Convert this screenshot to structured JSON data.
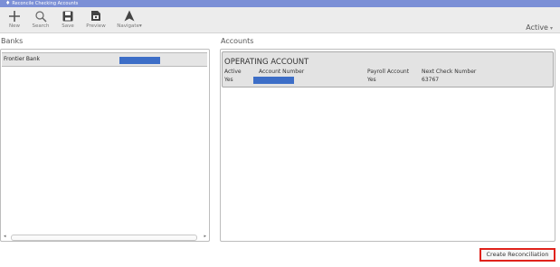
{
  "window": {
    "title": "Reconcile Checking Accounts"
  },
  "toolbar": {
    "new_label": "New",
    "search_label": "Search",
    "save_label": "Save",
    "preview_label": "Preview",
    "navigate_label": "Navigate",
    "navigate_caret": "▾",
    "status_value": "Active",
    "status_caret": "▾"
  },
  "banks": {
    "heading": "Banks",
    "rows": [
      {
        "name": "Frontier Bank"
      }
    ]
  },
  "accounts": {
    "heading": "Accounts",
    "cards": [
      {
        "name": "OPERATING ACCOUNT",
        "headers": {
          "active": "Active",
          "account_number": "Account Number",
          "payroll": "Payroll Account",
          "next_check": "Next Check Number"
        },
        "values": {
          "active": "Yes",
          "payroll": "Yes",
          "next_check": "63767"
        }
      }
    ]
  },
  "footer": {
    "create_label": "Create Reconciliation"
  },
  "icons": {
    "window": "window-icon",
    "new": "plus-icon",
    "search": "search-icon",
    "save": "save-icon",
    "preview": "preview-icon",
    "navigate": "navigate-icon"
  },
  "colors": {
    "titlebar": "#7b8fd6",
    "redaction": "#3d6ec7",
    "highlight_border": "#e0221b"
  }
}
